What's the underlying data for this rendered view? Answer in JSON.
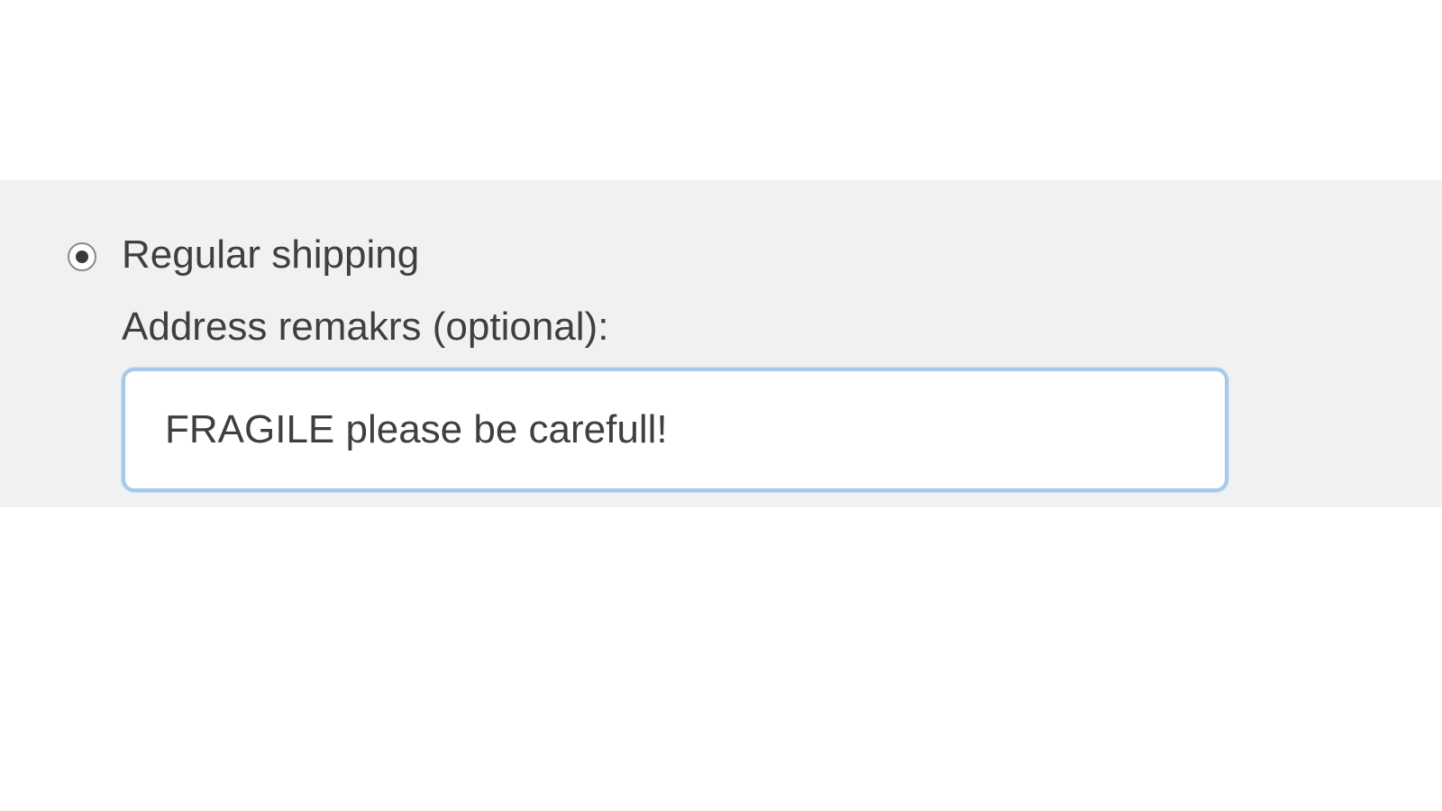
{
  "shipping": {
    "regular_option_label": "Regular shipping",
    "regular_option_selected": true,
    "remarks_label": "Address remakrs (optional):",
    "remarks_value": "FRAGILE please be carefull!"
  }
}
